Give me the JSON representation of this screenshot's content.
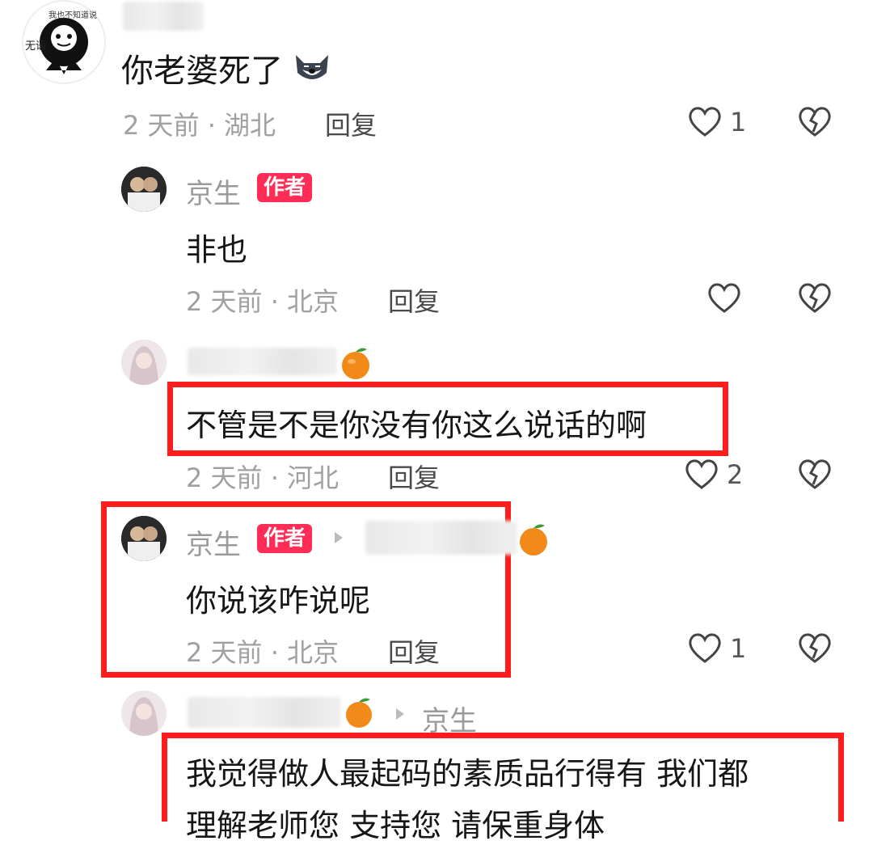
{
  "comments": [
    {
      "id": "c1",
      "text": "你老婆死了",
      "time": "2 天前 · 湖北",
      "reply": "回复",
      "likes": "1",
      "avatar_text_top": "我也不知道说什么",
      "avatar_text_left": "无语"
    },
    {
      "id": "c2",
      "author": "京生",
      "badge": "作者",
      "text": "非也",
      "time": "2 天前 · 北京",
      "reply": "回复"
    },
    {
      "id": "c3",
      "text": "不管是不是你没有你这么说话的啊",
      "time": "2 天前 · 河北",
      "reply": "回复",
      "likes": "2"
    },
    {
      "id": "c4",
      "author": "京生",
      "badge": "作者",
      "text": "你说该咋说呢",
      "time": "2 天前 · 北京",
      "reply": "回复",
      "likes": "1"
    },
    {
      "id": "c5",
      "reply_to": "京生",
      "text": "我觉得做人最起码的素质品行得有 我们都",
      "text_partial": "理解老师您 支持您 请保重身体"
    }
  ],
  "colors": {
    "highlight_border": "#ff1c1c",
    "author_badge": "#ff2d55",
    "meta_text": "#a0a0a0"
  },
  "icons": [
    "heart-icon",
    "broken-heart-icon",
    "tangerine-icon",
    "dog-emoji-icon",
    "reply-arrow-icon"
  ]
}
